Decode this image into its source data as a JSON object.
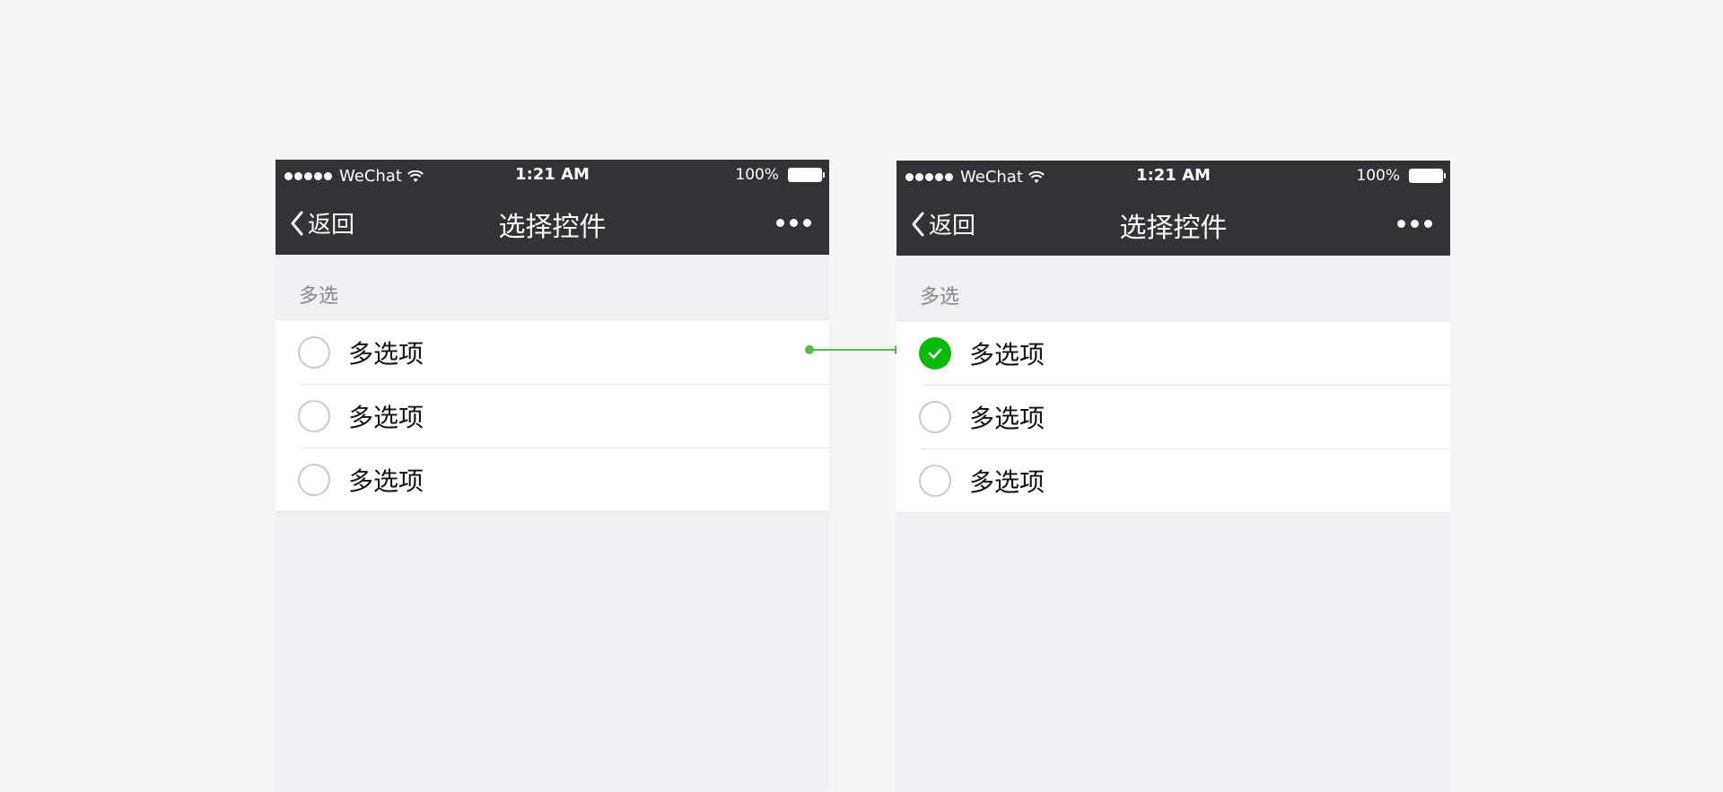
{
  "colors": {
    "navbar": "#333236",
    "background": "#efeff4",
    "checked": "#09bb07",
    "connector": "#4cbf4c"
  },
  "screens": [
    {
      "statusbar": {
        "carrier": "WeChat",
        "time": "1:21 AM",
        "battery": "100%"
      },
      "navbar": {
        "back_label": "返回",
        "title": "选择控件",
        "more_icon": "more-dots-icon"
      },
      "section_title": "多选",
      "items": [
        {
          "label": "多选项",
          "checked": false
        },
        {
          "label": "多选项",
          "checked": false
        },
        {
          "label": "多选项",
          "checked": false
        }
      ]
    },
    {
      "statusbar": {
        "carrier": "WeChat",
        "time": "1:21 AM",
        "battery": "100%"
      },
      "navbar": {
        "back_label": "返回",
        "title": "选择控件",
        "more_icon": "more-dots-icon"
      },
      "section_title": "多选",
      "items": [
        {
          "label": "多选项",
          "checked": true
        },
        {
          "label": "多选项",
          "checked": false
        },
        {
          "label": "多选项",
          "checked": false
        }
      ]
    }
  ]
}
